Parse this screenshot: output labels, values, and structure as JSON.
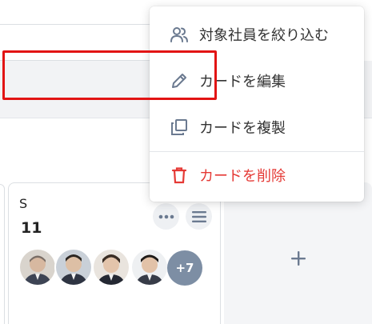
{
  "menu": {
    "filter_label": "対象社員を絞り込む",
    "edit_label": "カードを編集",
    "copy_label": "カードを複製",
    "delete_label": "カードを削除"
  },
  "card": {
    "title": "S",
    "count": "11",
    "more_count": "+7"
  },
  "icons": {
    "filter": "users-icon",
    "edit": "pencil-icon",
    "copy": "copy-icon",
    "delete": "trash-icon",
    "more": "ellipsis-icon",
    "menu": "hamburger-icon",
    "add": "plus-icon"
  },
  "colors": {
    "delete": "#e53935",
    "highlight": "#e21414",
    "avatar_more": "#7d8ea4"
  }
}
